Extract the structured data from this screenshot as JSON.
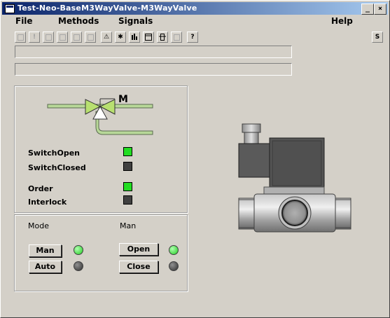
{
  "window": {
    "title": "Test-Neo-BaseM3WayValve-M3WayValve"
  },
  "menu": {
    "file": "File",
    "methods": "Methods",
    "signals": "Signals",
    "help": "Help"
  },
  "toolbar": {
    "warning": "⚠",
    "asterisk": "✱",
    "help": "?",
    "right_icon": "S"
  },
  "diagram": {
    "motor_label": "M"
  },
  "signals": {
    "switch_open": "SwitchOpen",
    "switch_closed": "SwitchClosed",
    "order": "Order",
    "interlock": "Interlock"
  },
  "leds": {
    "switch_open": "#22dd22",
    "switch_closed": "#404040",
    "order": "#22dd22",
    "interlock": "#404040"
  },
  "mode_panel": {
    "mode_label": "Mode",
    "man_label": "Man",
    "man_button": "Man",
    "auto_button": "Auto",
    "open_button": "Open",
    "close_button": "Close"
  }
}
